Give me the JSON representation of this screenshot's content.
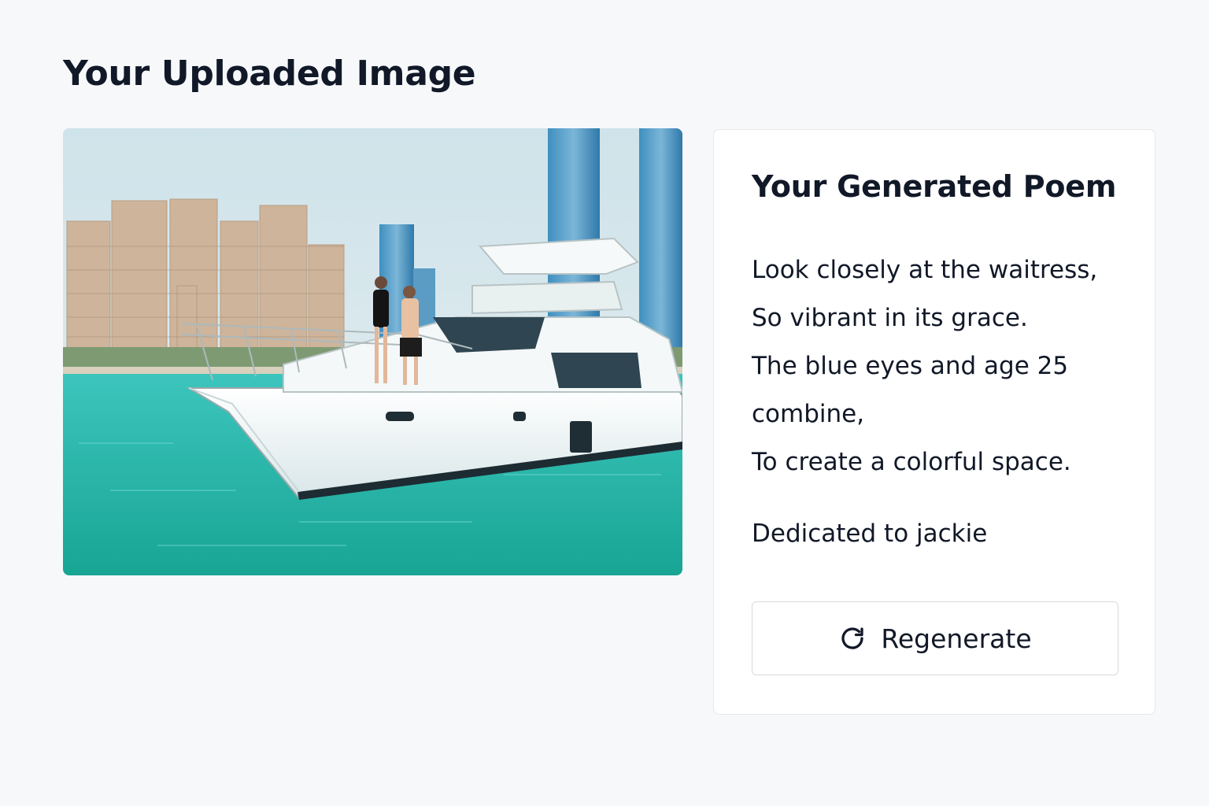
{
  "page": {
    "title": "Your Uploaded Image"
  },
  "uploaded_image": {
    "description_icon": "photo-yacht"
  },
  "poem_card": {
    "title": "Your Generated Poem",
    "lines": [
      "Look closely at the waitress,",
      "So vibrant in its grace.",
      "The blue eyes and age 25 combine,",
      "To create a colorful space."
    ],
    "dedication": "Dedicated to jackie",
    "regenerate_button": {
      "label": "Regenerate",
      "icon": "refresh-icon"
    }
  },
  "colors": {
    "background": "#f7f8fa",
    "card": "#ffffff",
    "text": "#111827",
    "border": "#d6d9de"
  }
}
